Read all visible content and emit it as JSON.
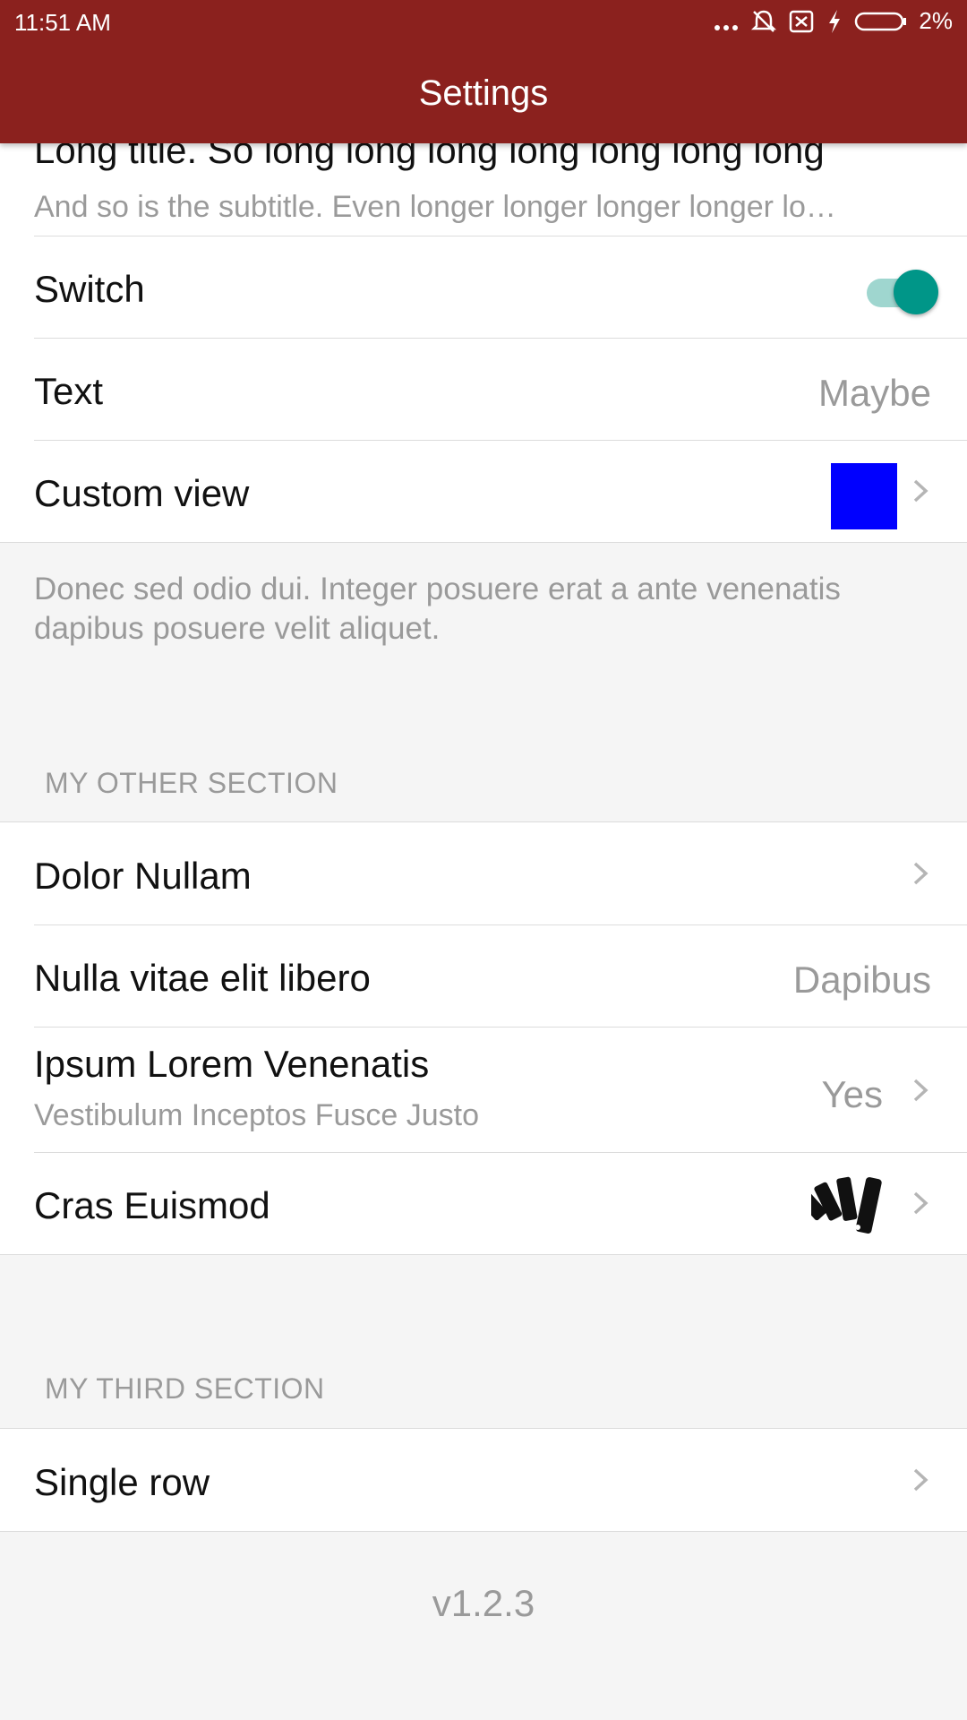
{
  "status_bar": {
    "time": "11:51 AM",
    "battery_pct": "2%",
    "icons": [
      "more-dots-icon",
      "bell-off-icon",
      "sim-off-icon",
      "charging-icon",
      "battery-icon"
    ]
  },
  "app_bar": {
    "title": "Settings"
  },
  "section1": {
    "long_row": {
      "title": "Long title. So long long long long long long long",
      "subtitle": "And so is the subtitle. Even longer longer longer longer lo…"
    },
    "switch_row": {
      "label": "Switch",
      "checked": true
    },
    "text_row": {
      "label": "Text",
      "value": "Maybe"
    },
    "custom_row": {
      "label": "Custom view",
      "swatch_color": "#0000ff"
    },
    "footer": "Donec sed odio dui. Integer posuere erat a ante venenatis dapibus posuere velit aliquet."
  },
  "section2": {
    "header": "MY OTHER SECTION",
    "rows": [
      {
        "label": "Dolor Nullam"
      },
      {
        "label": "Nulla vitae elit libero",
        "value": "Dapibus"
      },
      {
        "label": "Ipsum Lorem Venenatis",
        "subtitle": "Vestibulum Inceptos Fusce Justo",
        "value": "Yes"
      },
      {
        "label": "Cras Euismod",
        "icon": "swatches-fan-icon"
      }
    ]
  },
  "section3": {
    "header": "MY THIRD SECTION",
    "rows": [
      {
        "label": "Single row"
      }
    ]
  },
  "version": "v1.2.3",
  "colors": {
    "primary": "#8b211e",
    "switch_on": "#009688",
    "secondary_text": "#9a9a9a",
    "background": "#f5f5f5"
  }
}
